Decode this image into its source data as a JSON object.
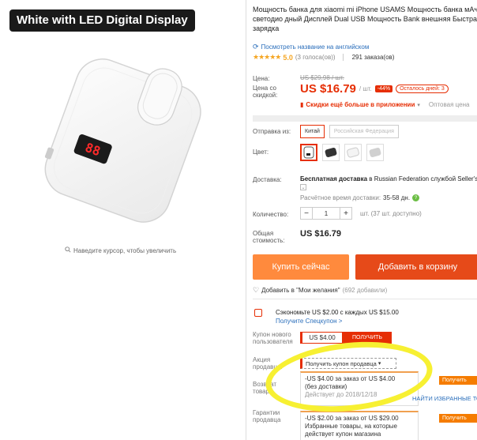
{
  "gallery": {
    "badge": "White with LED Digital Display",
    "zoom_hint": "Наведите курсор, чтобы увеличить",
    "led_text": "88"
  },
  "product": {
    "title": "Мощность банка для xiaomi mi iPhone USAMS Мощность банка мАч светодио дный Дисплей Dual USB Мощность Bank внешняя Быстрая зарядка",
    "translate_link": "Посмотреть название на английском",
    "rating_value": "5.0",
    "votes": "(3 голоса(ов))",
    "orders": "291 заказа(ов)"
  },
  "price": {
    "label": "Цена:",
    "old": "US $29,98 / шт.",
    "discount_label": "Цена со скидкой:",
    "current": "US $16.79",
    "unit": "/ шт.",
    "discount_badge": "-44%",
    "days_left": "Осталось дней: 3",
    "app_promo": "Скидки ещё больше в приложении",
    "wholesale": "Оптовая цена"
  },
  "shipping": {
    "label": "Отправка из:",
    "options": [
      "Китай",
      "Российская Федерация"
    ],
    "selected": "Китай"
  },
  "color": {
    "label": "Цвет:",
    "swatches": [
      "white",
      "black",
      "white",
      "gray"
    ]
  },
  "delivery": {
    "label": "Доставка:",
    "text_bold": "Бесплатная доставка",
    "text_rest": "в Russian Federation службой Seller's",
    "est_label": "Расчётное время доставки:",
    "est_value": "35-58 дн."
  },
  "quantity": {
    "label": "Количество:",
    "value": "1",
    "minus": "−",
    "plus": "+",
    "note": "шт. (37 шт. доступно)"
  },
  "total": {
    "label": "Общая стоимость:",
    "value": "US $16.79"
  },
  "actions": {
    "buy": "Купить сейчас",
    "cart": "Добавить в корзину",
    "wishlist": "Добавить в \"Мои желания\"",
    "wishlist_count": "(692 добавили)"
  },
  "promo": {
    "save_text": "Сэкономьте US $2.00 с каждых US $15.00",
    "save_link": "Получите Спецкупон >",
    "new_user_label": "Купон нового пользователя",
    "new_user_amount": "US $4.00",
    "new_user_button": "ПОЛУЧИТЬ",
    "seller_label": "Акция продавца:",
    "seller_dropdown": "Получить купон продавца",
    "return_label": "Возврат товара",
    "warranty_label": "Гарантии продавца",
    "coupon1_line1": "-US $4.00 за заказ от US $4.00",
    "coupon1_line2": "(без доставки)",
    "coupon1_expiry": "Действует до 2018/12/18",
    "coupon2_line1": "-US $2.00 за заказ от US $29.00",
    "coupon2_line2": "Избранные товары, на которые",
    "coupon2_line3": "действует купон магазина",
    "get_btn": "Получить",
    "find_all": "НАЙТИ ИЗБРАННЫЕ ТОВАРЫ"
  },
  "colors": {
    "accent": "#e62e04",
    "buy_btn": "#ff8a3d",
    "cart_btn": "#e64a19",
    "link": "#2a6ebb",
    "highlight": "#f7f032"
  }
}
